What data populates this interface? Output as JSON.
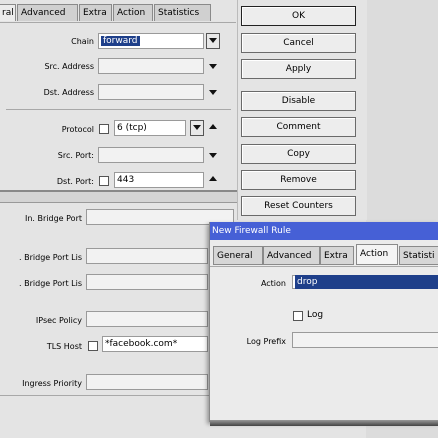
{
  "back_window": {
    "tabs": [
      "ral",
      "Advanced",
      "Extra",
      "Action",
      "Statistics"
    ],
    "fields": {
      "chain_label": "Chain",
      "chain_value": "forward",
      "src_address_label": "Src. Address",
      "dst_address_label": "Dst. Address",
      "protocol_label": "Protocol",
      "protocol_value": "6 (tcp)",
      "src_port_label": "Src. Port:",
      "dst_port_label": "Dst. Port:",
      "dst_port_value": "443",
      "in_bridge_port_label": "In. Bridge Port",
      "in_bridge_port_list_label": ". Bridge Port Lis",
      "out_bridge_port_list_label": ". Bridge Port Lis",
      "ipsec_policy_label": "IPsec Policy",
      "tls_host_label": "TLS Host",
      "tls_host_value": "*facebook.com*",
      "ingress_priority_label": "Ingress Priority"
    },
    "buttons": {
      "ok": "OK",
      "cancel": "Cancel",
      "apply": "Apply",
      "disable": "Disable",
      "comment": "Comment",
      "copy": "Copy",
      "remove": "Remove",
      "reset_counters": "Reset Counters"
    }
  },
  "front_window": {
    "title": "New Firewall Rule",
    "tabs": [
      "General",
      "Advanced",
      "Extra",
      "Action",
      "Statisti"
    ],
    "action_label": "Action",
    "action_value": "drop",
    "log_label": "Log",
    "log_prefix_label": "Log Prefix"
  }
}
